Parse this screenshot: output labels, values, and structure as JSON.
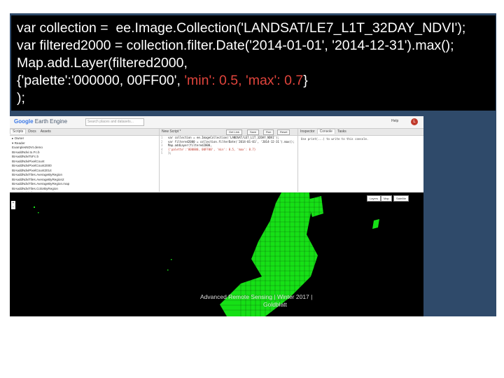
{
  "banner": {
    "line1": "var collection =  ee.Image.Collection('LANDSAT/LE7_L1T_32DAY_NDVI');",
    "line2": "var filtered2000 = collection.filter.Date('2014-01-01', '2014-12-31').max();",
    "line3": "Map.add.Layer(filtered2000,",
    "line4_a": "{'palette':'000000, 00FF00', ",
    "line4_b": "'min': 0.5, 'max': 0.7",
    "line4_c": "}",
    "line5": ");"
  },
  "app": {
    "logo_prefix": "Google",
    "logo_suffix": " Earth Engine",
    "search_placeholder": "Search places and datasets...",
    "help_label": "Help",
    "user_initial": "L",
    "left_tabs": [
      "Scripts",
      "Docs",
      "Assets"
    ],
    "scripts": [
      "▸ Owner",
      "  ▾ Reader",
      "     ExamplesNDVI.demo",
      "     BIAaddNdvi.to.Fc.b",
      "     BIAaddNdviToFc.b",
      "     BIAaddNdviPixelCount",
      "     BIAaddNdviPixelCount2000",
      "     BIAaddNdviPixelCount2014",
      "     BIAaddNdviTiles.AverageByRegion",
      "     BIAaddNdviTiles.AverageByRegion2",
      "     BIAaddNdviTiles.AverageByRegion.map",
      "     BIAaddNdviTiles.ColorByRegion",
      "     BIAaddNdviTiles.ColorByRegion.mean",
      "     BIAaddNdviFiltered2014.LeeSquare"
    ],
    "editor_title": "New Script *",
    "editor_buttons": [
      "Get Link",
      "Save",
      "Run",
      "Reset"
    ],
    "editor_lines": [
      "var collection = ee.ImageCollection('LANDSAT/LE7_L1T_32DAY_NDVI');",
      "var filtered2000 = collection.filterDate('2014-01-01', '2014-12-31').max();",
      "Map.addLayer(filtered2000,",
      "{'palette':'000000, 00FF00', 'min': 0.5, 'max': 0.7}",
      ");"
    ],
    "right_tabs": [
      "Inspector",
      "Console",
      "Tasks"
    ],
    "console_text": "Use print(...) to write to this console.",
    "map_buttons": [
      "Layers",
      "Map",
      "Satellite"
    ],
    "zoom_in": "+",
    "zoom_out": "−"
  },
  "watermark": {
    "line1": "Advanced Remote Sensing | Winter 2017 |",
    "line2": "Goldblatt"
  },
  "colors": {
    "slide_bg": "#2f4a6a",
    "code_bg": "#000000",
    "code_red": "#e0443c",
    "ndvi_green": "#16e016"
  }
}
